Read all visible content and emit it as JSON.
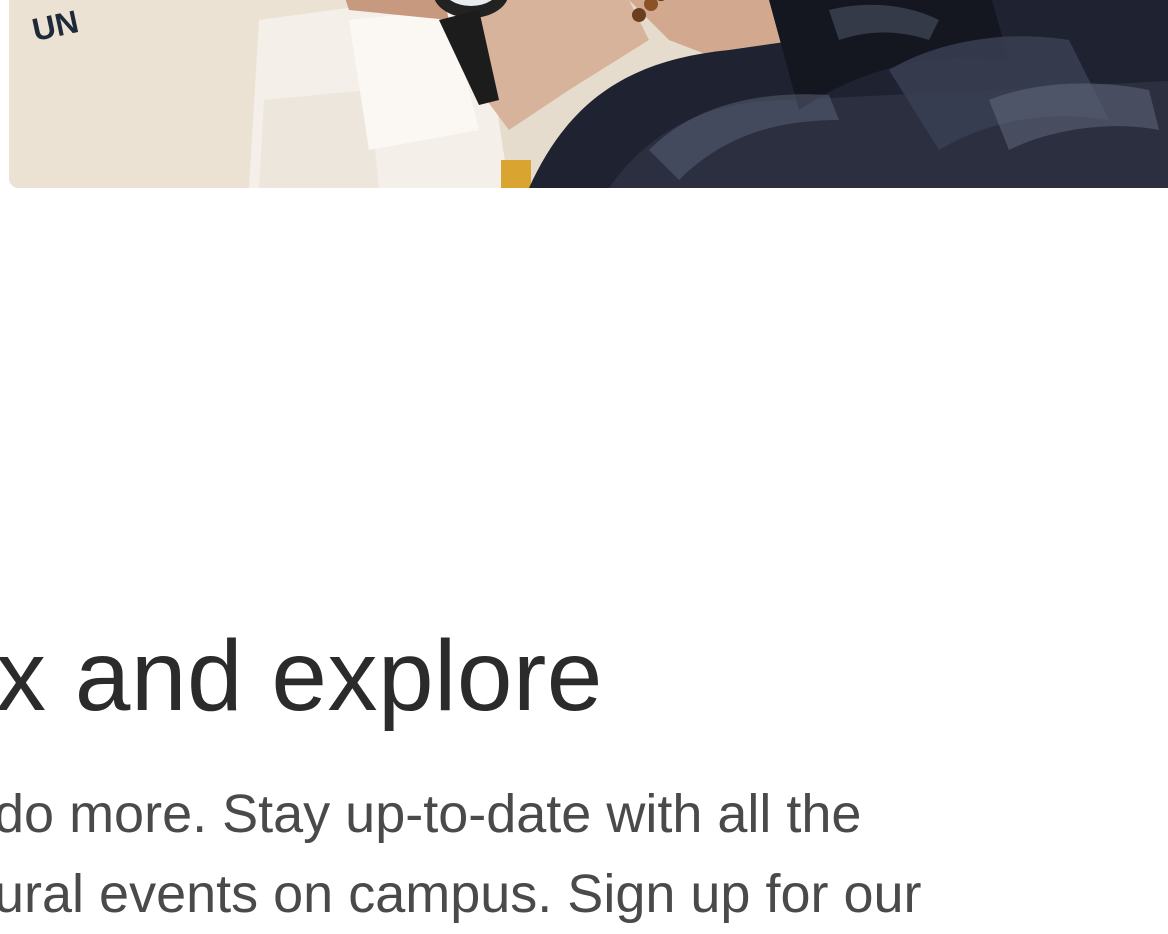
{
  "hero": {
    "image_alt": "People picking out printed t-shirts",
    "shirt_print": "UN"
  },
  "section": {
    "heading": "x and explore",
    "body_lines": [
      " do more. Stay up-to-date with all the",
      "ural events on campus. Sign up for our"
    ]
  },
  "colors": {
    "heading": "#2b2b2b",
    "body": "#4a4a4a",
    "background": "#ffffff"
  }
}
